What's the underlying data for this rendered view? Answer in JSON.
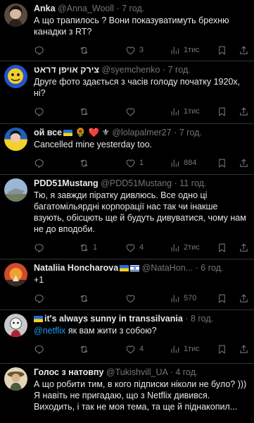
{
  "tweets": [
    {
      "name": "Anka",
      "handle": "@Anna_Wooll",
      "time": "7 год.",
      "text": "А що трапилось ? Вони показуватимуть брехню канадки з RT?",
      "replies": "",
      "retweets": "",
      "likes": "3",
      "views": "1тис"
    },
    {
      "name": "צירק אויפן דראט",
      "handle": "@syemchenko",
      "time": "7 год.",
      "text": "Друге фото здається з часів голоду початку 1920х, ні?",
      "replies": "",
      "retweets": "",
      "likes": "",
      "views": "1тис"
    },
    {
      "name": "ой все",
      "name_suffix": "🌻 ❤️ ⚜",
      "handle": "@lolapalmer27",
      "time": "7 год.",
      "text": "Cancelled mine yesterday too.",
      "replies": "",
      "retweets": "",
      "likes": "1",
      "views": "884"
    },
    {
      "name": "PDD51Mustang",
      "handle": "@PDD51Mustang",
      "time": "11 год.",
      "text": "Тю, я завжди піратку дивлюсь. Все одно ці багатомільярдні корпорації нас так чи інакше взують, обісцють ще й будуть дивуватися, чому нам не до вподоби.",
      "replies": "",
      "retweets": "1",
      "likes": "4",
      "views": "2тис"
    },
    {
      "name": "Nataliia Honcharova",
      "handle": "@NataHon...",
      "time": "6 год.",
      "text": "+1",
      "replies": "",
      "retweets": "",
      "likes": "",
      "views": "570"
    },
    {
      "name": "it's always sunny in transsilvania",
      "handle": "",
      "time": "8 год.",
      "mention": "@netflix",
      "text": " як вам жити з собою?",
      "replies": "",
      "retweets": "",
      "likes": "4",
      "views": "1тис"
    },
    {
      "name": "Голос з натовпу",
      "handle": "@Tukishvill_UA",
      "time": "4 год.",
      "text": "А що робити тим, в кого підписки ніколи не було? ))) Я навіть не пригадаю, що з Netflix дивився. Виходить, і так не моя тема, та ще й піднакопил..."
    }
  ],
  "separator": "·",
  "colors": {
    "background": "#000000",
    "text": "#e7e9ea",
    "secondary": "#71767b",
    "link": "#1d9bf0",
    "divider": "#2f3336"
  },
  "icons": [
    "reply-icon",
    "retweet-icon",
    "like-icon",
    "views-icon",
    "bookmark-icon",
    "share-icon"
  ]
}
